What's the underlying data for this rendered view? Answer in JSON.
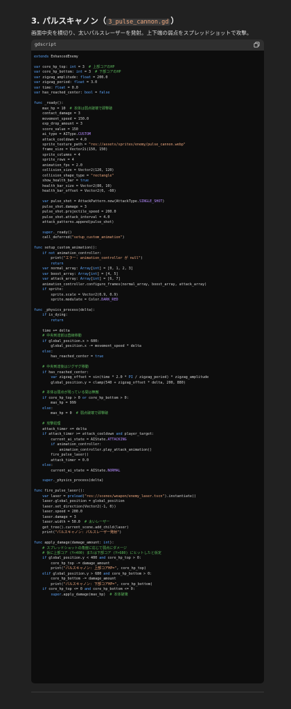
{
  "heading": {
    "title": "3. パルスキャノン（",
    "file": "3_pulse_cannon.gd",
    "close": "）"
  },
  "description": "画面中央を横切り、太いパルスレーザーを発射。上下端の弱点をスプレッドショットで攻撃。",
  "code": {
    "language": "gdscript",
    "copy_icon": "copy-icon",
    "lines": [
      "extends EnhancedEnemy",
      "",
      "var core_hp_top: int = 3  # 上部コアのHP",
      "var core_hp_bottom: int = 3  # 下部コアのHP",
      "var zigzag_amplitude: float = 200.0",
      "var zigzag_period: float = 3.0",
      "var time: float = 0.0",
      "var has_reached_center: bool = false",
      "",
      "func _ready():",
      "    max_hp = 10  # 本体は弱点破壊で即撃破",
      "    contact_damage = 3",
      "    movement_speed = 150.0",
      "    exp_drop_amount = 3",
      "    score_value = 150",
      "    ai_type = AIType.CUSTOM",
      "    attack_cooldown = 4.0",
      "    sprite_texture_path = \"res://assets/sprites/enemy/pulse_cannon.webp\"",
      "    frame_size = Vector2i(150, 150)",
      "    sprite_columns = 4",
      "    sprite_rows = 4",
      "    animation_fps = 2.0",
      "    collision_size = Vector2(120, 120)",
      "    collision_shape_type = \"rectangle\"",
      "    show_health_bar = true",
      "    health_bar_size = Vector2(80, 10)",
      "    health_bar_offset = Vector2(0, -60)",
      "",
      "    var pulse_shot = AttackPattern.new(AttackType.SINGLE_SHOT)",
      "    pulse_shot.damage = 3",
      "    pulse_shot.projectile_speed = 200.0",
      "    pulse_shot.attack_interval = 4.0",
      "    attack_patterns.append(pulse_shot)",
      "",
      "    super._ready()",
      "    call_deferred(\"setup_custom_animation\")",
      "",
      "func setup_custom_animation():",
      "    if not animation_controller:",
      "        print(\"エラー: animation_controller が null\")",
      "        return",
      "    var normal_array: Array[int] = [0, 1, 2, 3]",
      "    var boost_array: Array[int] = [4, 5]",
      "    var attack_array: Array[int] = [6, 7]",
      "    animation_controller.configure_frames(normal_array, boost_array, attack_array)",
      "    if sprite:",
      "        sprite.scale = Vector2(0.9, 0.9)",
      "        sprite.modulate = Color.DARK_RED",
      "",
      "func _physics_process(delta):",
      "    if is_dying:",
      "        return",
      "",
      "    time += delta",
      "    # 中央到達前は直線移動",
      "    if global_position.x > 600:",
      "        global_position.x -= movement_speed * delta",
      "    else:",
      "        has_reached_center = true",
      "",
      "    # 中央到達後はジグザグ移動",
      "    if has_reached_center:",
      "        var zigzag_offset = sin(time * 2.0 * PI / zigzag_period) * zigzag_amplitude",
      "        global_position.y = clamp(540 + zigzag_offset * delta, 200, 880)",
      "",
      "    # 本体は弱点が残っている間は無敵",
      "    if core_hp_top > 0 or core_hp_bottom > 0:",
      "        max_hp = 999",
      "    else:",
      "        max_hp = 0  # 弱点破壊で即撃破",
      "",
      "    # 攻撃処理",
      "    attack_timer += delta",
      "    if attack_timer >= attack_cooldown and player_target:",
      "        current_ai_state = AIState.ATTACKING",
      "        if animation_controller:",
      "            animation_controller.play_attack_animation()",
      "        fire_pulse_laser()",
      "        attack_timer = 0.0",
      "    else:",
      "        current_ai_state = AIState.NORMAL",
      "",
      "    super._physics_process(delta)",
      "",
      "func fire_pulse_laser():",
      "    var laser = preload(\"res://scenes/weapon/enemy_laser.tscn\").instantiate()",
      "    laser.global_position = global_position",
      "    laser.set_direction(Vector2(-1, 0))",
      "    laser.speed = 200.0",
      "    laser.damage = 3",
      "    laser.width = 50.0  # 太いレーザー",
      "    get_tree().current_scene.add_child(laser)",
      "    print(\"パルスキャノン: パルスレーザー発射\")",
      "",
      "func apply_damage(damage_amount: int):",
      "    # スプレッドショットの角度に応じて弱点にダメージ",
      "    # 仮に上部コア (Y<400) または下部コア (Y>680) にヒットしたと仮定",
      "    if global_position.y < 400 and core_hp_top > 0:",
      "        core_hp_top -= damage_amount",
      "        print(\"パルスキャノン: 上部コアHP=\", core_hp_top)",
      "    elif global_position.y > 680 and core_hp_bottom > 0:",
      "        core_hp_bottom -= damage_amount",
      "        print(\"パルスキャノン: 下部コアHP=\", core_hp_bottom)",
      "    if core_hp_top <= 0 and core_hp_bottom <= 0:",
      "        super.apply_damage(max_hp)  # 本体破壊"
    ]
  }
}
